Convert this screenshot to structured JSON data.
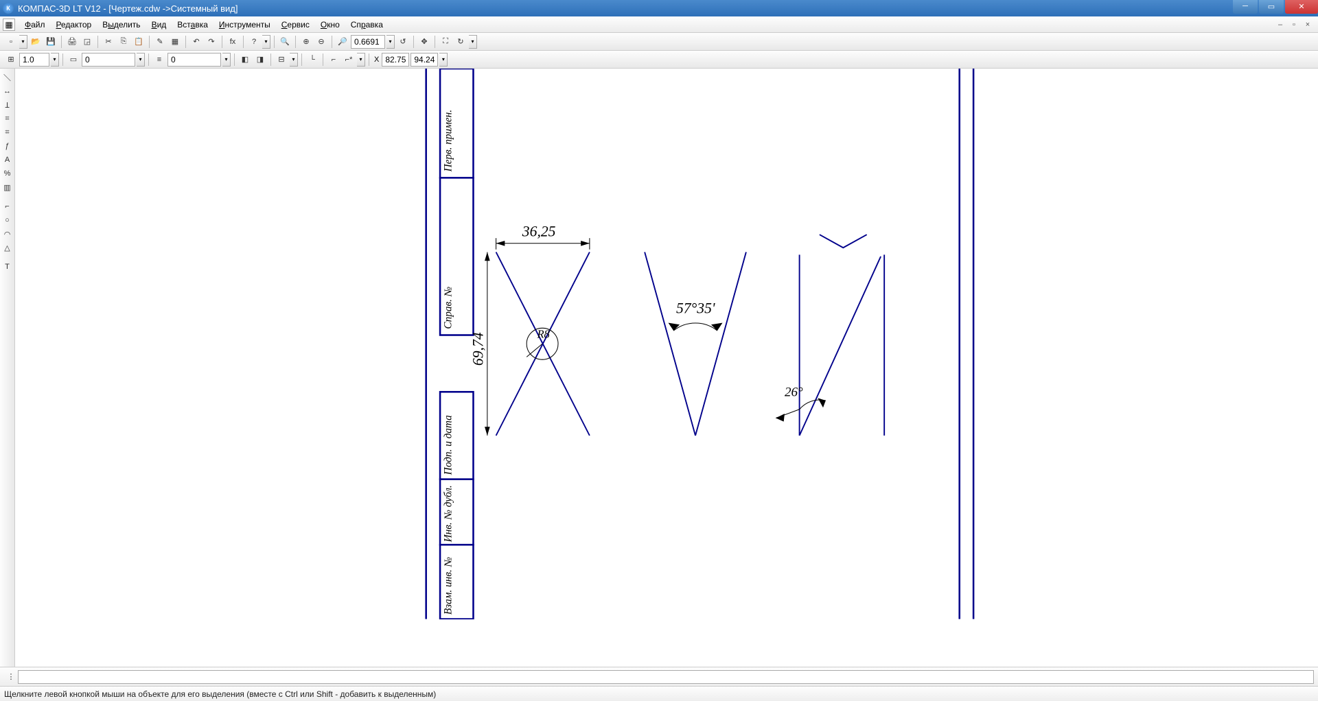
{
  "window": {
    "title": "КОМПАС-3D LT V12 - [Чертеж.cdw ->Системный вид]"
  },
  "menus": {
    "file": "Файл",
    "edit": "Редактор",
    "select": "Выделить",
    "view": "Вид",
    "insert": "Вставка",
    "tools": "Инструменты",
    "service": "Сервис",
    "window": "Окно",
    "help": "Справка"
  },
  "toolbar1": {
    "zoom_value": "0.6691"
  },
  "toolbar2": {
    "step": "1.0",
    "style_num1": "0",
    "style_num2": "0",
    "coord_x": "82.75",
    "coord_y": "94.24"
  },
  "drawing": {
    "dim_width": "36,25",
    "dim_height": "69,74",
    "angle1": "57°35'",
    "angle2": "26°",
    "stamps": [
      "Перв. примен.",
      "Справ. №",
      "Подп. и дата",
      "Инв. № дубл.",
      "Взам. инв. №"
    ]
  },
  "status": {
    "hint": "Щелкните левой кнопкой мыши на объекте для его выделения (вместе с Ctrl или Shift - добавить к выделенным)"
  }
}
